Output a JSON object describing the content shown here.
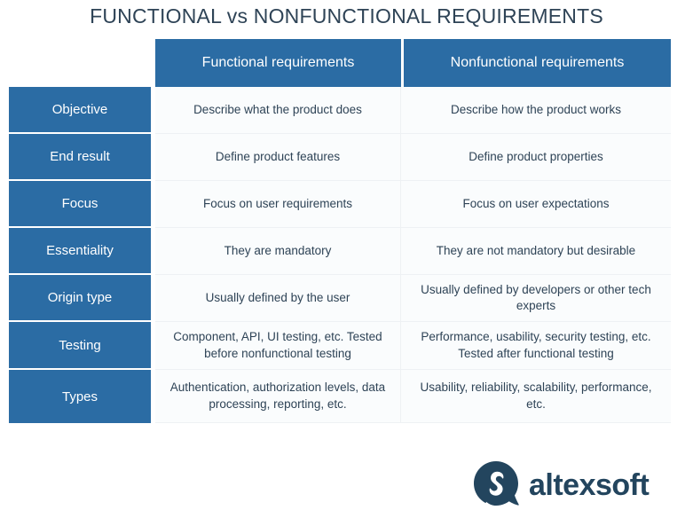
{
  "title": "FUNCTIONAL vs NONFUNCTIONAL REQUIREMENTS",
  "table": {
    "corner_label": "",
    "columns": [
      "Functional requirements",
      "Nonfunctional requirements"
    ],
    "rows": [
      {
        "label": "Objective",
        "functional": "Describe what the product does",
        "nonfunctional": "Describe how the product works"
      },
      {
        "label": "End result",
        "functional": "Define product features",
        "nonfunctional": "Define product properties"
      },
      {
        "label": "Focus",
        "functional": "Focus on user requirements",
        "nonfunctional": "Focus on user expectations"
      },
      {
        "label": "Essentiality",
        "functional": "They are mandatory",
        "nonfunctional": "They are not mandatory but desirable"
      },
      {
        "label": "Origin type",
        "functional": "Usually defined by the user",
        "nonfunctional": "Usually defined by developers or other tech experts"
      },
      {
        "label": "Testing",
        "functional": "Component, API, UI testing, etc. Tested before nonfunctional testing",
        "nonfunctional": "Performance, usability, security testing, etc. Tested after functional testing"
      },
      {
        "label": "Types",
        "functional": "Authentication, authorization levels, data processing, reporting, etc.",
        "nonfunctional": "Usability, reliability, scalability, performance, etc."
      }
    ]
  },
  "logo": {
    "wordmark": "altexsoft",
    "mark_icon": "speech-bubble-a-icon",
    "mark_color": "#23455e"
  },
  "colors": {
    "header_blue": "#2b6ca4",
    "label_blue": "#2b6ca4",
    "body_background": "#fafcfd",
    "text_dark": "#2e4356",
    "grid_line": "#eef1f4",
    "logo_navy": "#23455e"
  }
}
